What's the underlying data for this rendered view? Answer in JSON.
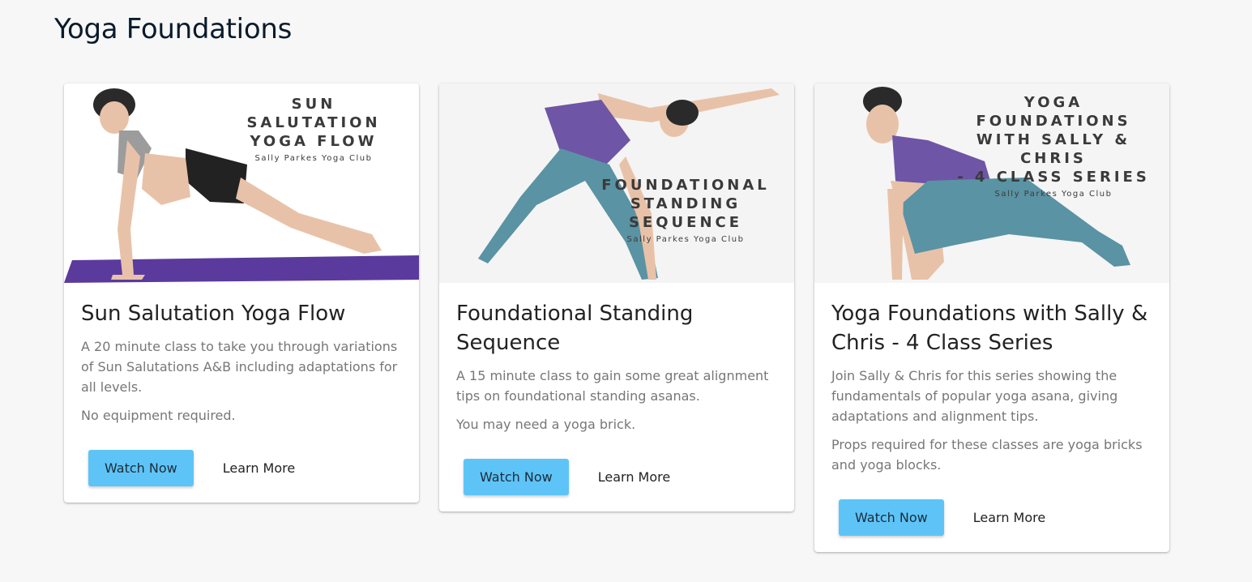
{
  "page": {
    "title": "Yoga Foundations"
  },
  "cards": [
    {
      "image_title": "SUN SALUTATION\nYOGA FLOW",
      "image_subtitle": "Sally Parkes Yoga Club",
      "title": "Sun Salutation Yoga Flow",
      "description": "A 20 minute class to take you through variations of Sun Salutations A&B including adaptations for all levels.",
      "note": "No equipment required.",
      "primary_label": "Watch Now",
      "secondary_label": "Learn More"
    },
    {
      "image_title": "FOUNDATIONAL\nSTANDING SEQUENCE",
      "image_subtitle": "Sally Parkes Yoga Club",
      "title": "Foundational Standing Sequence",
      "description": "A 15 minute class to gain some great alignment tips on foundational standing asanas.",
      "note": "You may need a yoga brick.",
      "primary_label": "Watch Now",
      "secondary_label": "Learn More"
    },
    {
      "image_title": "YOGA FOUNDATIONS\nWITH SALLY & CHRIS\n- 4 CLASS SERIES",
      "image_subtitle": "Sally Parkes Yoga Club",
      "title": "Yoga Foundations with Sally & Chris - 4 Class Series",
      "description": "Join Sally & Chris for this series showing the fundamentals of popular yoga asana, giving adaptations and alignment tips.",
      "note": "Props required for these classes are yoga bricks and yoga blocks.",
      "primary_label": "Watch Now",
      "secondary_label": "Learn More"
    }
  ],
  "colors": {
    "button_primary": "#5ec4f7",
    "mat_purple": "#5b3a9e",
    "top_purple": "#6e55a6",
    "leggings_teal": "#5a93a3"
  }
}
